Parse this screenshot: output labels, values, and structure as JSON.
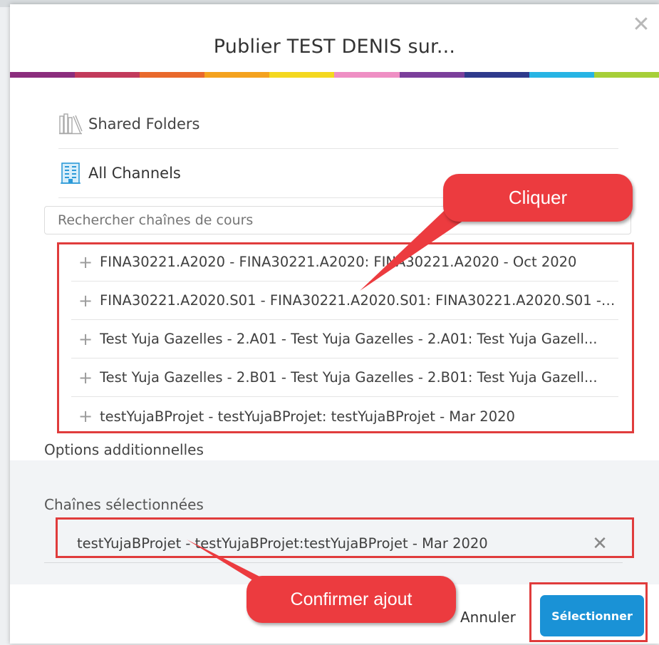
{
  "dialog": {
    "title": "Publier TEST DENIS sur...",
    "close_icon": "close-x-icon"
  },
  "rainbow_colors": [
    "#8b2d7d",
    "#c23a5b",
    "#e9692c",
    "#f4a21e",
    "#f4d81f",
    "#ef8fc4",
    "#7b3f9b",
    "#2e3a8c",
    "#27b4e4",
    "#a6cf38"
  ],
  "nav": {
    "shared_folders": {
      "label": "Shared Folders",
      "icon": "bookshelf-icon"
    },
    "all_channels": {
      "label": "All Channels",
      "icon": "building-icon"
    }
  },
  "search": {
    "placeholder": "Rechercher chaînes de cours"
  },
  "channels": [
    {
      "label": "FINA30221.A2020 - FINA30221.A2020: FINA30221.A2020 - Oct 2020"
    },
    {
      "label": "FINA30221.A2020.S01 - FINA30221.A2020.S01: FINA30221.A2020.S01 - J..."
    },
    {
      "label": "Test Yuja Gazelles - 2.A01 - Test Yuja Gazelles - 2.A01: Test Yuja Gazell..."
    },
    {
      "label": "Test Yuja Gazelles - 2.B01 - Test Yuja Gazelles - 2.B01: Test Yuja Gazell..."
    },
    {
      "label": "testYujaBProjet - testYujaBProjet: testYujaBProjet - Mar 2020"
    }
  ],
  "options_label": "Options additionnelles",
  "selected": {
    "label": "Chaînes sélectionnées",
    "items": [
      {
        "label": "testYujaBProjet - testYujaBProjet:testYujaBProjet - Mar 2020"
      }
    ]
  },
  "buttons": {
    "cancel": "Annuler",
    "select": "Sélectionner"
  },
  "annotations": {
    "callout_click": "Cliquer",
    "callout_confirm": "Confirmer ajout"
  },
  "colors": {
    "annotation_red": "#e03c3c",
    "callout_red": "#ec3b3f",
    "primary_blue": "#1a92d6"
  }
}
